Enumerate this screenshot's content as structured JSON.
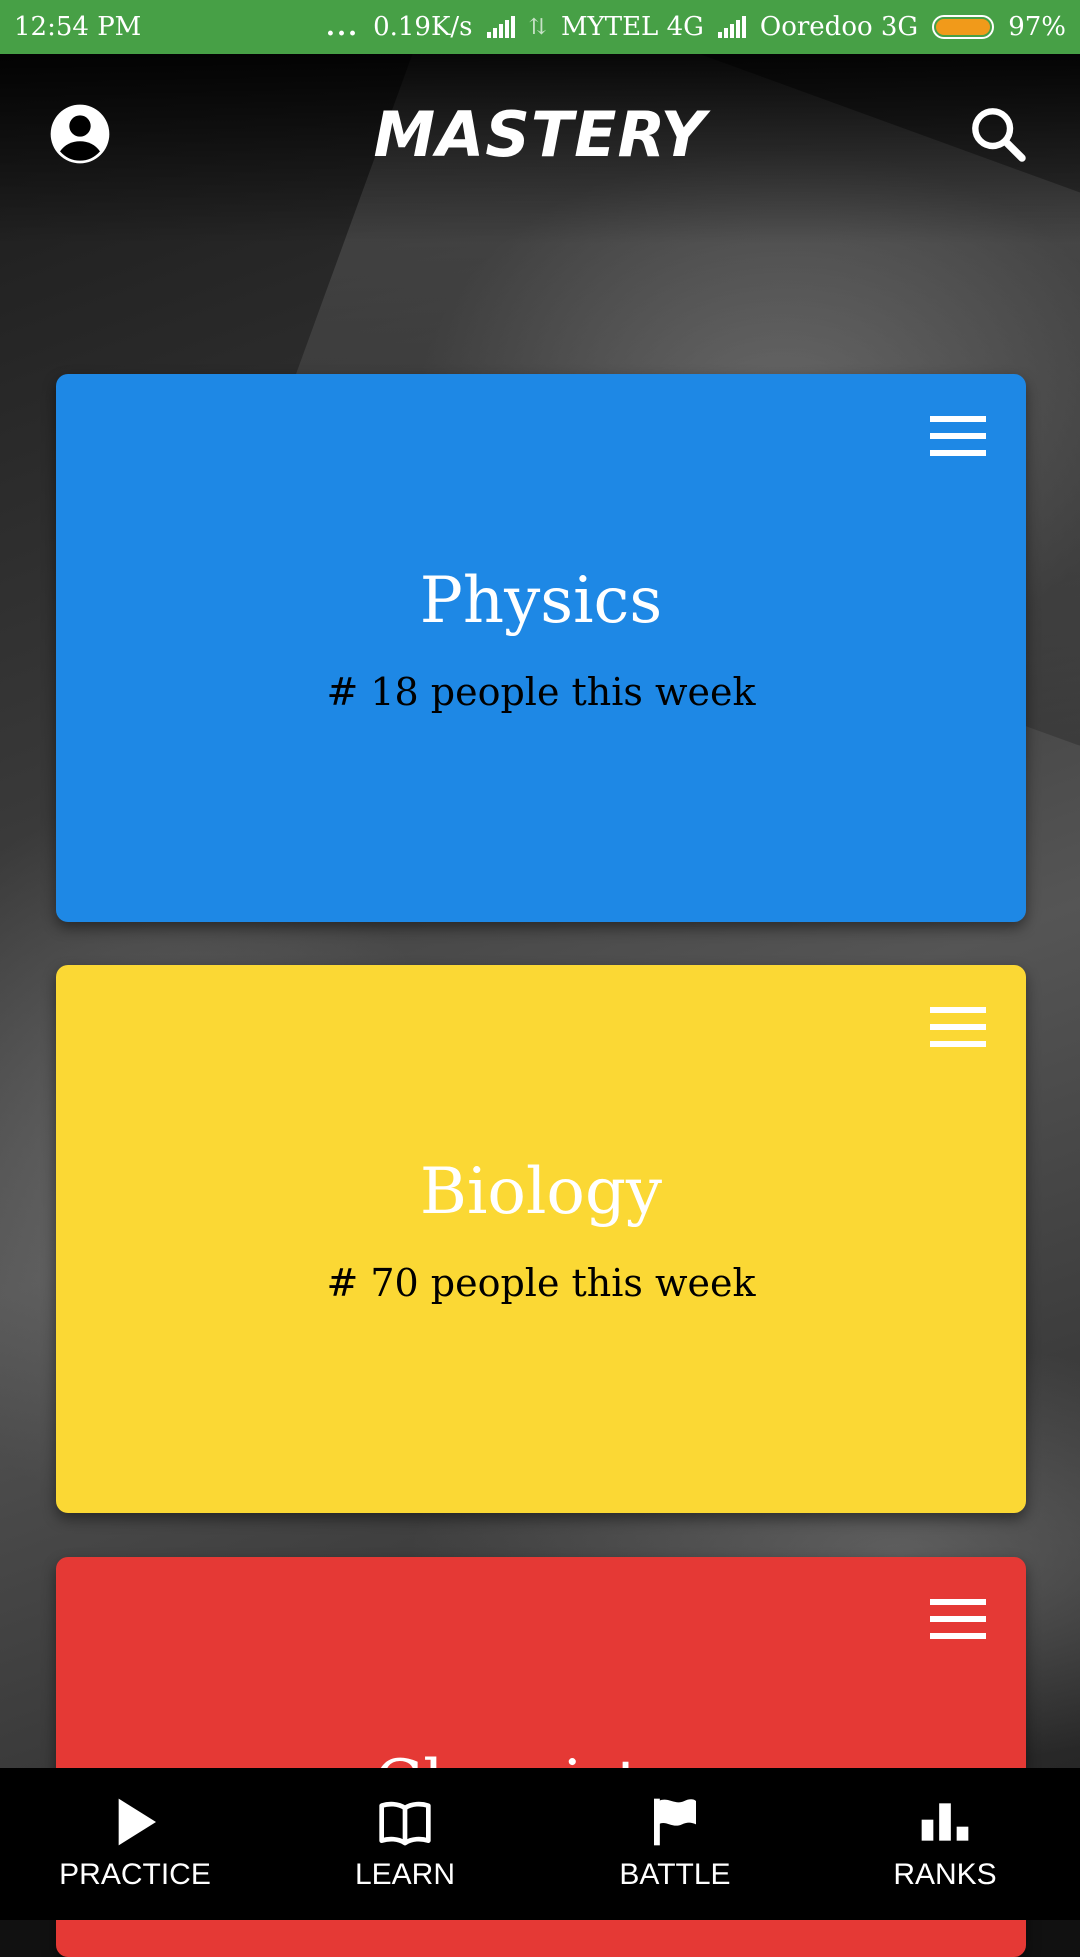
{
  "status_bar": {
    "time": "12:54 PM",
    "dots": "...",
    "speed": "0.19K/s",
    "carrier1": "MYTEL 4G",
    "carrier2": "Ooredoo 3G",
    "battery": "97%",
    "battery_level": 0.97,
    "battery_color": "#f19a1a",
    "bar_color": "#47a046"
  },
  "app_bar": {
    "title": "MASTERY",
    "profile_icon": "account-circle-icon",
    "search_icon": "search-icon"
  },
  "cards": [
    {
      "title": "Physics",
      "subtitle": "# 18 people this week",
      "color": "#1e88e5",
      "menu_icon": "hamburger-menu-icon"
    },
    {
      "title": "Biology",
      "subtitle": "# 70 people this week",
      "color": "#fbd834",
      "menu_icon": "hamburger-menu-icon"
    },
    {
      "title": "Chemistry",
      "subtitle": "",
      "color": "#e53935",
      "menu_icon": "hamburger-menu-icon"
    }
  ],
  "bottom_nav": {
    "items": [
      {
        "label": "PRACTICE",
        "icon": "play-icon"
      },
      {
        "label": "LEARN",
        "icon": "book-icon"
      },
      {
        "label": "BATTLE",
        "icon": "flag-icon"
      },
      {
        "label": "RANKS",
        "icon": "bar-chart-icon"
      }
    ]
  }
}
